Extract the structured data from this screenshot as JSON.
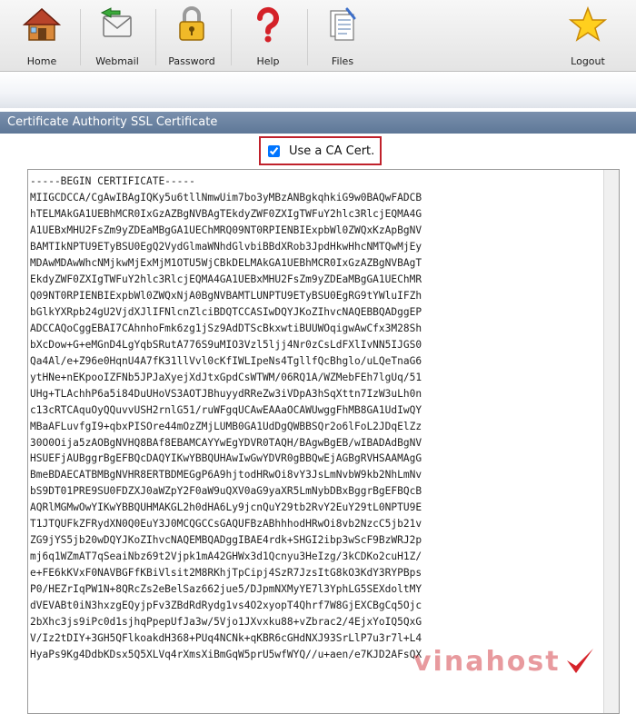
{
  "toolbar": {
    "home_label": "Home",
    "webmail_label": "Webmail",
    "password_label": "Password",
    "help_label": "Help",
    "files_label": "Files",
    "logout_label": "Logout"
  },
  "section": {
    "title": "Certificate Authority SSL Certificate"
  },
  "use_ca_cert": {
    "label": "Use a CA Cert.",
    "checked": true
  },
  "certificate": {
    "lines": [
      "-----BEGIN CERTIFICATE-----",
      "MIIGCDCCA/CgAwIBAgIQKy5u6tllNmwUim7bo3yMBzANBgkqhkiG9w0BAQwFADCB",
      "hTELMAkGA1UEBhMCR0IxGzAZBgNVBAgTEkdyZWF0ZXIgTWFuY2hlc3RlcjEQMA4G",
      "A1UEBxMHU2FsZm9yZDEaMBgGA1UEChMRQ09NT0RPIENBIExpbWl0ZWQxKzApBgNV",
      "BAMTIkNPTU9ETyBSU0EgQ2VydGlmaWNhdGlvbiBBdXRob3JpdHkwHhcNMTQwMjEy",
      "MDAwMDAwWhcNMjkwMjExMjM1OTU5WjCBkDELMAkGA1UEBhMCR0IxGzAZBgNVBAgT",
      "EkdyZWF0ZXIgTWFuY2hlc3RlcjEQMA4GA1UEBxMHU2FsZm9yZDEaMBgGA1UEChMR",
      "Q09NT0RPIENBIExpbWl0ZWQxNjA0BgNVBAMTLUNPTU9ETyBSU0EgRG9tYWluIFZh",
      "bGlkYXRpb24gU2VjdXJlIFNlcnZlciBDQTCCASIwDQYJKoZIhvcNAQEBBQADggEP",
      "ADCCAQoCggEBAI7CAhnhoFmk6zg1jSz9AdDTScBkxwtiBUUWOqigwAwCfx3M28Sh",
      "bXcDow+G+eMGnD4LgYqbSRutA776S9uMIO3Vzl5ljj4Nr0zCsLdFXlIvNN5IJGS0",
      "Qa4Al/e+Z96e0HqnU4A7fK31llVvl0cKfIWLIpeNs4TgllfQcBhglo/uLQeTnaG6",
      "ytHNe+nEKpooIZFNb5JPJaXyejXdJtxGpdCsWTWM/06RQ1A/WZMebFEh7lgUq/51",
      "UHg+TLAchhP6a5i84DuUHoVS3AOTJBhuyydRReZw3iVDpA3hSqXttn7IzW3uLh0n",
      "c13cRTCAquOyQQuvvUSH2rnlG51/ruWFgqUCAwEAAaOCAWUwggFhMB8GA1UdIwQY",
      "MBaAFLuvfgI9+qbxPISOre44mOzZMjLUMB0GA1UdDgQWBBSQr2o6lFoL2JDqElZz",
      "30O0Oija5zAOBgNVHQ8BAf8EBAMCAYYwEgYDVR0TAQH/BAgwBgEB/wIBADAdBgNV",
      "HSUEFjAUBggrBgEFBQcDAQYIKwYBBQUHAwIwGwYDVR0gBBQwEjAGBgRVHSAAMAgG",
      "BmeBDAECATBMBgNVHR8ERTBDMEGgP6A9hjtodHRwOi8vY3JsLmNvbW9kb2NhLmNv",
      "bS9DT01PRE9SU0FDZXJ0aWZpY2F0aW9uQXV0aG9yaXR5LmNybDBxBggrBgEFBQcB",
      "AQRlMGMwOwYIKwYBBQUHMAKGL2h0dHA6Ly9jcnQuY29tb2RvY2EuY29tL0NPTU9E",
      "T1JTQUFkZFRydXN0Q0EuY3J0MCQGCCsGAQUFBzABhhhodHRwOi8vb2NzcC5jb21v",
      "ZG9jYS5jb20wDQYJKoZIhvcNAQEMBQADggIBAE4rdk+SHGI2ibp3wScF9BzWRJ2p",
      "mj6q1WZmAT7qSeaiNbz69t2Vjpk1mA42GHWx3d1Qcnyu3HeIzg/3kCDKo2cuH1Z/",
      "e+FE6kKVxF0NAVBGFfKBiVlsit2M8RKhjTpCipj4SzR7JzsItG8kO3KdY3RYPBps",
      "P0/HEZrIqPW1N+8QRcZs2eBelSaz662jue5/DJpmNXMyYE7l3YphLG5SEXdoltMY",
      "dVEVABt0iN3hxzgEQyjpFv3ZBdRdRydg1vs4O2xyopT4Qhrf7W8GjEXCBgCq5Ojc",
      "2bXhc3js9iPc0d1sjhqPpepUfJa3w/5Vjo1JXvxku88+vZbrac2/4EjxYoIQ5QxG",
      "V/Iz2tDIY+3GH5QFlkoakdH368+PUq4NCNk+qKBR6cGHdNXJ93SrLlP7u3r7l+L4",
      "HyaPs9Kg4DdbKDsx5Q5XLVq4rXmsXiBmGqW5prU5wfWYQ//u+aen/e7KJD2AFsQX"
    ]
  },
  "watermark": {
    "text": "vinahost"
  }
}
